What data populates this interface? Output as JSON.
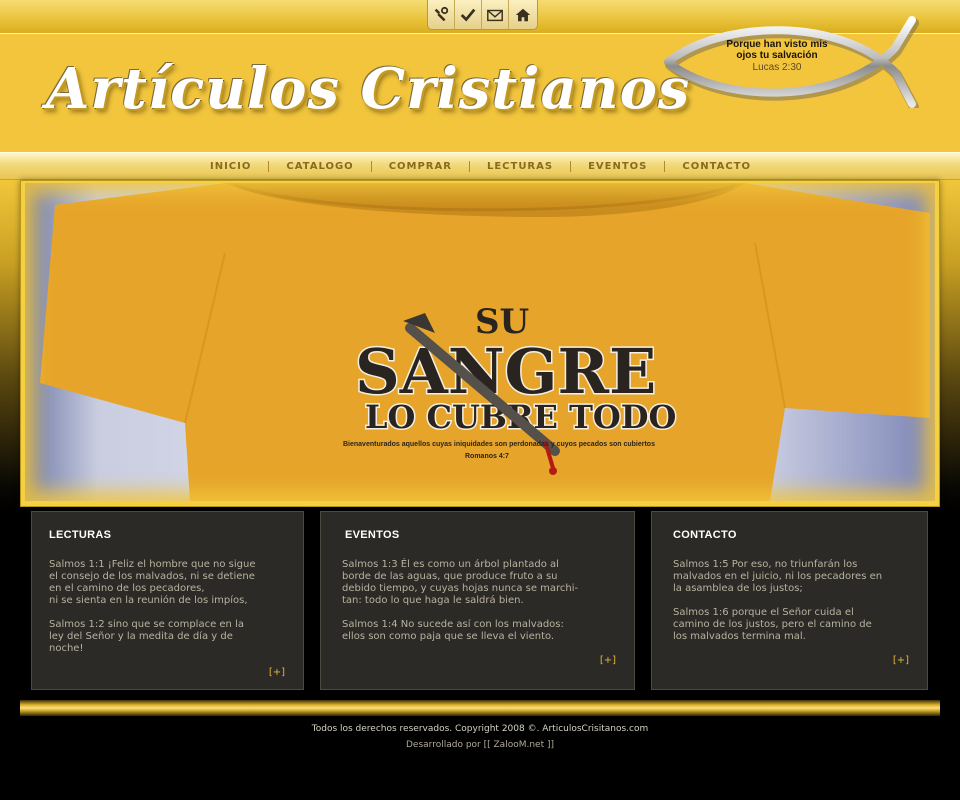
{
  "toolbar": {
    "icons": [
      "tools-icon",
      "check-icon",
      "mail-icon",
      "home-icon"
    ]
  },
  "header": {
    "logo_text": "Artículos Cristianos",
    "verse_text": "Porque han visto mis ojos tu salvación",
    "verse_ref": "Lucas 2:30"
  },
  "nav": {
    "items": [
      {
        "label": "INICIO"
      },
      {
        "label": "CATALOGO"
      },
      {
        "label": "COMPRAR"
      },
      {
        "label": "LECTURAS"
      },
      {
        "label": "EVENTOS"
      },
      {
        "label": "CONTACTO"
      }
    ]
  },
  "banner": {
    "line1": "SU",
    "line2": "SANGRE",
    "line3": "LO CUBRE TODO",
    "caption": "Bienaventurados aquellos cuyas iniquidades son perdonadas y cuyos pecados son cubiertos",
    "reference": "Romanos 4:7"
  },
  "boxes": [
    {
      "title": "LECTURAS",
      "text": "Salmos 1:1 ¡Feliz el hombre que no sigue\nel consejo de los malvados, ni se detiene\nen el camino de los pecadores,\nni se sienta en la reunión de los impíos,\n\nSalmos 1:2 sino que se complace en la\nley del Señor y la medita de día y de\nnoche!",
      "more": "[+]"
    },
    {
      "title": "EVENTOS",
      "text": "Salmos 1:3 Él es como un árbol plantado al\nborde de las aguas, que produce fruto a su\ndebido tiempo, y cuyas hojas nunca se marchi-\ntan: todo lo que haga le saldrá bien.\n\nSalmos 1:4 No sucede así con los malvados:\nellos son como paja que se lleva el viento.",
      "more": "[+]"
    },
    {
      "title": "CONTACTO",
      "text": "Salmos 1:5 Por eso, no triunfarán los\nmalvados en el juicio, ni los pecadores en\nla asamblea de los justos;\n\nSalmos 1:6 porque el Señor cuida el\ncamino de los justos, pero el camino de\nlos malvados termina mal.",
      "more": "[+]"
    }
  ],
  "footer": {
    "copyright": "Todos los derechos reservados. Copyright 2008 ©. ArticulosCrisitanos.com",
    "developed_prefix": "Desarrollado por",
    "developer": "[[ ZalooM.net ]]"
  },
  "colors": {
    "gold": "#f2c53d",
    "nav_text": "#8a6a1c",
    "box_bg": "#2c2a26",
    "link": "#e4b43a"
  }
}
